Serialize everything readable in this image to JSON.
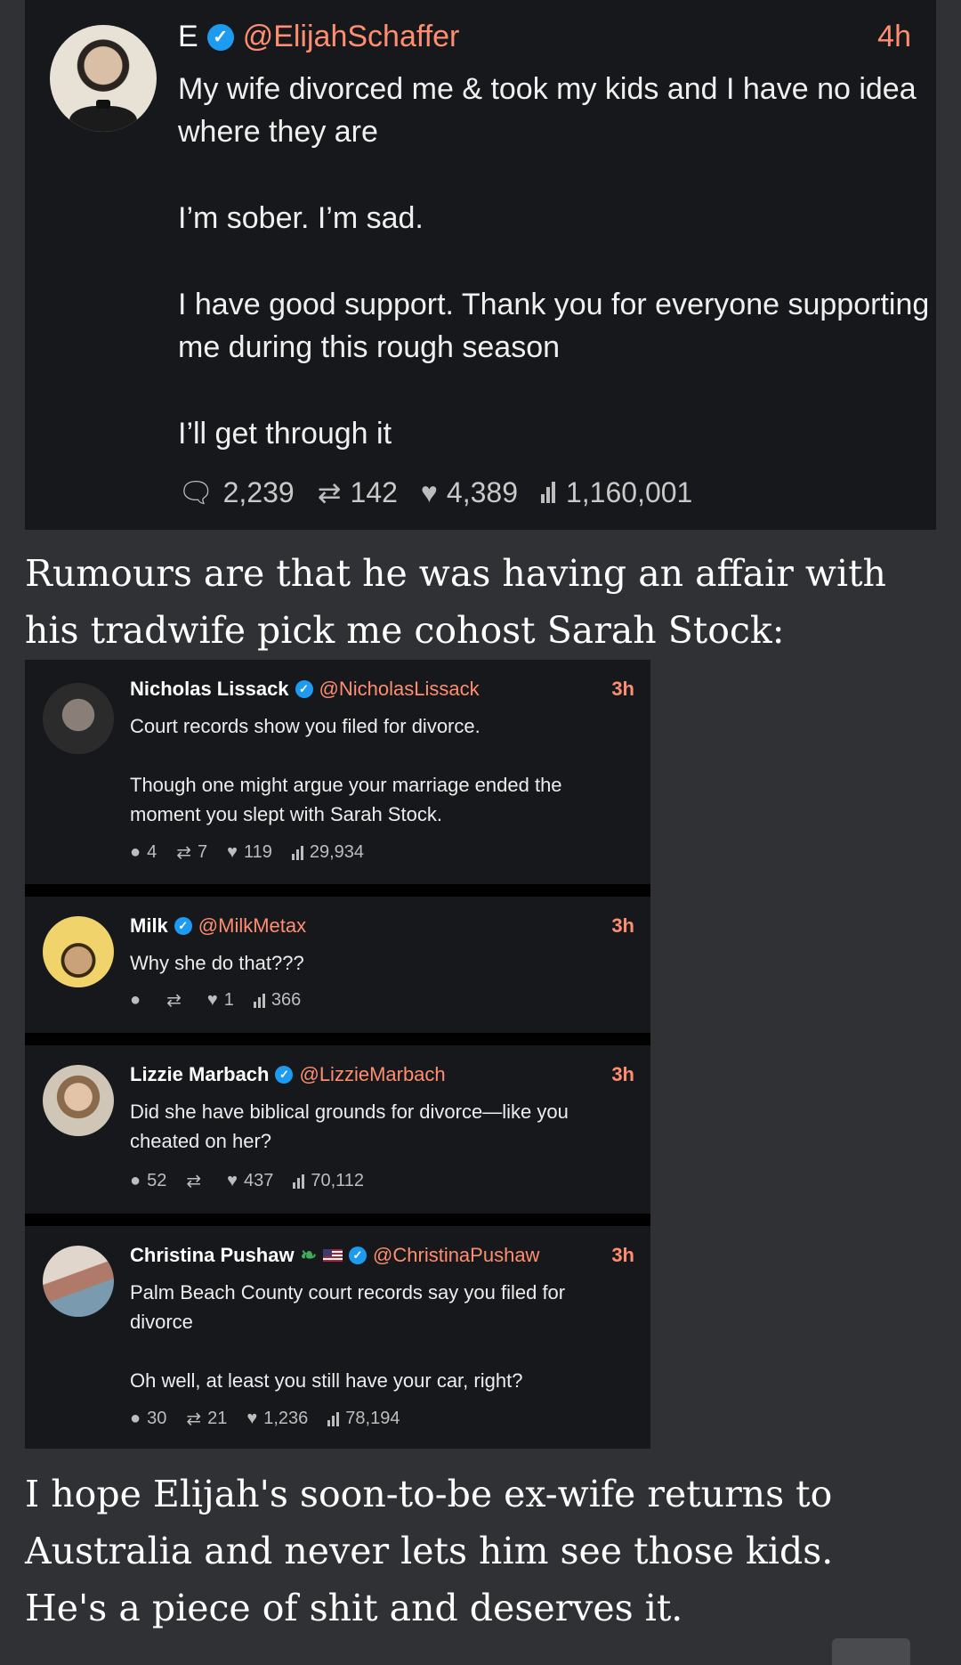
{
  "main_tweet": {
    "initial": "E",
    "handle": "@ElijahSchaffer",
    "time": "4h",
    "paragraphs": [
      "My wife divorced me & took my kids and I have no idea where they are",
      "I’m sober. I’m sad.",
      "I have good support. Thank you for everyone supporting me during this rough season",
      "I’ll get through it"
    ],
    "replies": "2,239",
    "retweets": "142",
    "likes": "4,389",
    "views": "1,160,001"
  },
  "comment_text_1": "Rumours are that he was having an affair with his tradwife pick me cohost Sarah Stock:",
  "replies": [
    {
      "name": "Nicholas Lissack",
      "handle": "@NicholasLissack",
      "time": "3h",
      "paragraphs": [
        "Court records show you filed for divorce.",
        "Though one might argue your marriage ended the moment you slept with Sarah Stock."
      ],
      "replies": "4",
      "retweets": "7",
      "likes": "119",
      "views": "29,934",
      "avatar_color": "#3a3a3a"
    },
    {
      "name": "Milk",
      "handle": "@MilkMetax",
      "time": "3h",
      "paragraphs": [
        "Why she do that???"
      ],
      "replies": "",
      "retweets": "",
      "likes": "1",
      "views": "366",
      "avatar_color": "#f1d36b"
    },
    {
      "name": "Lizzie Marbach",
      "handle": "@LizzieMarbach",
      "time": "3h",
      "paragraphs": [
        "Did she have biblical grounds for divorce—like you cheated on her?"
      ],
      "replies": "52",
      "retweets": "",
      "likes": "437",
      "views": "70,112",
      "avatar_color": "#b9a58e"
    },
    {
      "name": "Christina Pushaw",
      "handle": "@ChristinaPushaw",
      "time": "3h",
      "paragraphs": [
        "Palm Beach County court records say you filed for divorce",
        "Oh well, at least you still have your car, right?"
      ],
      "replies": "30",
      "retweets": "21",
      "likes": "1,236",
      "views": "78,194",
      "avatar_color": "#c9b3a6"
    }
  ],
  "comment_text_2": "I hope Elijah's soon-to-be ex-wife returns to Australia and never lets him see those kids. He's a piece of shit and deserves it.",
  "icons": {
    "reply": "speech-bubble-icon",
    "retweet": "retweet-icon",
    "like": "heart-icon",
    "views": "bar-chart-icon",
    "verified": "verified-badge-icon"
  },
  "colors": {
    "background": "#303134",
    "card": "#16181b",
    "handle": "#ff8e70",
    "verified": "#1d9bf0"
  }
}
